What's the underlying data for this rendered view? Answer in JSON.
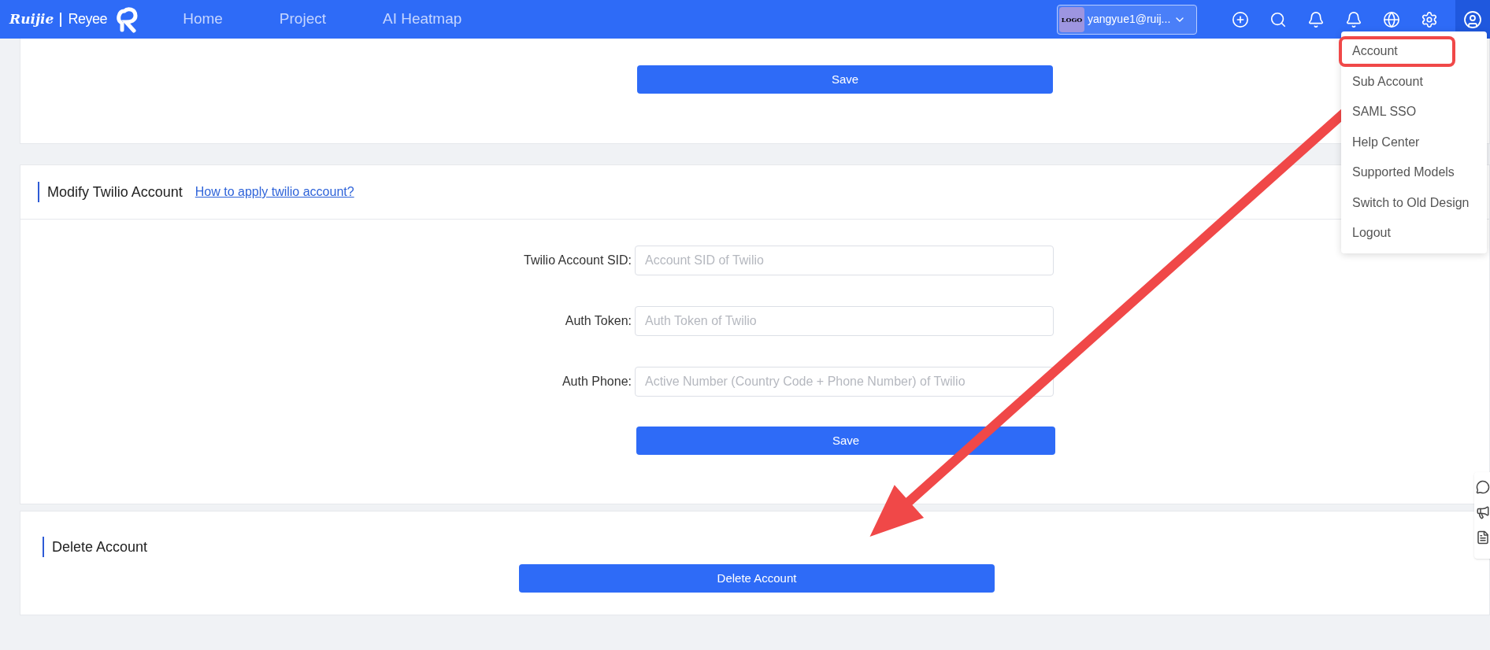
{
  "header": {
    "brand": {
      "primary": "Ruijie",
      "secondary": "Reyee"
    },
    "nav": [
      {
        "label": "Home",
        "selected": false
      },
      {
        "label": "Project",
        "selected": false
      },
      {
        "label": "AI Heatmap",
        "selected": false
      }
    ],
    "account": {
      "logo": "LOGO",
      "email": "yangyue1@ruij..."
    }
  },
  "menu": {
    "items": [
      {
        "label": "Account",
        "highlighted": true
      },
      {
        "label": "Sub Account",
        "highlighted": false
      },
      {
        "label": "SAML SSO",
        "highlighted": false
      },
      {
        "label": "Help Center",
        "highlighted": false
      },
      {
        "label": "Supported Models",
        "highlighted": false
      },
      {
        "label": "Switch to Old Design",
        "highlighted": false
      },
      {
        "label": "Logout",
        "highlighted": false
      }
    ]
  },
  "top_card": {
    "button": "Save"
  },
  "twilio_card": {
    "title": "Modify Twilio Account",
    "link": "How to apply twilio account?",
    "fields": [
      {
        "label": "Twilio Account SID:",
        "placeholder": "Account SID of Twilio"
      },
      {
        "label": "Auth Token:",
        "placeholder": "Auth Token of Twilio"
      },
      {
        "label": "Auth Phone:",
        "placeholder": "Active Number (Country Code + Phone Number) of Twilio"
      }
    ],
    "button": "Save"
  },
  "delete_card": {
    "title": "Delete Account",
    "button": "Delete Account"
  }
}
